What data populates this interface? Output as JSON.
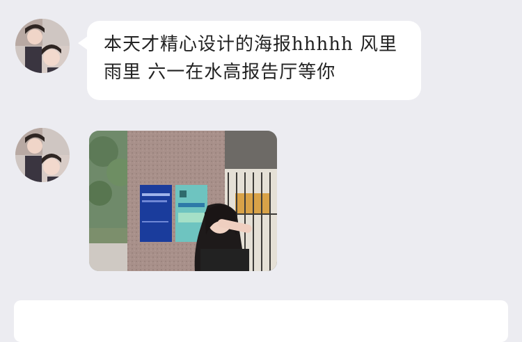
{
  "chat": {
    "messages": [
      {
        "type": "text",
        "text": "本天才精心设计的海报hhhhh 风里雨里 六一在水高报告厅等你"
      },
      {
        "type": "image",
        "image_description": "photo-of-girl-with-posters"
      }
    ]
  },
  "colors": {
    "background": "#ececf1",
    "bubble": "#ffffff",
    "text": "#222222"
  }
}
